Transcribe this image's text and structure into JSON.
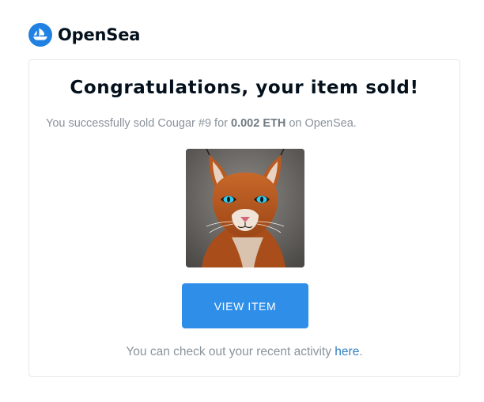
{
  "brand": {
    "name": "OpenSea",
    "logo_icon": "opensea-sailboat-icon",
    "accent_color": "#2081e2"
  },
  "email": {
    "headline": "Congratulations, your item sold!",
    "summary": {
      "prefix": "You successfully sold Cougar #9 for ",
      "price": "0.002 ETH",
      "suffix": " on OpenSea."
    },
    "item": {
      "image_icon": "cougar-nft-image"
    },
    "cta_label": "VIEW ITEM",
    "footer": {
      "prefix": "You can check out your recent activity ",
      "link_label": "here",
      "suffix": "."
    }
  }
}
